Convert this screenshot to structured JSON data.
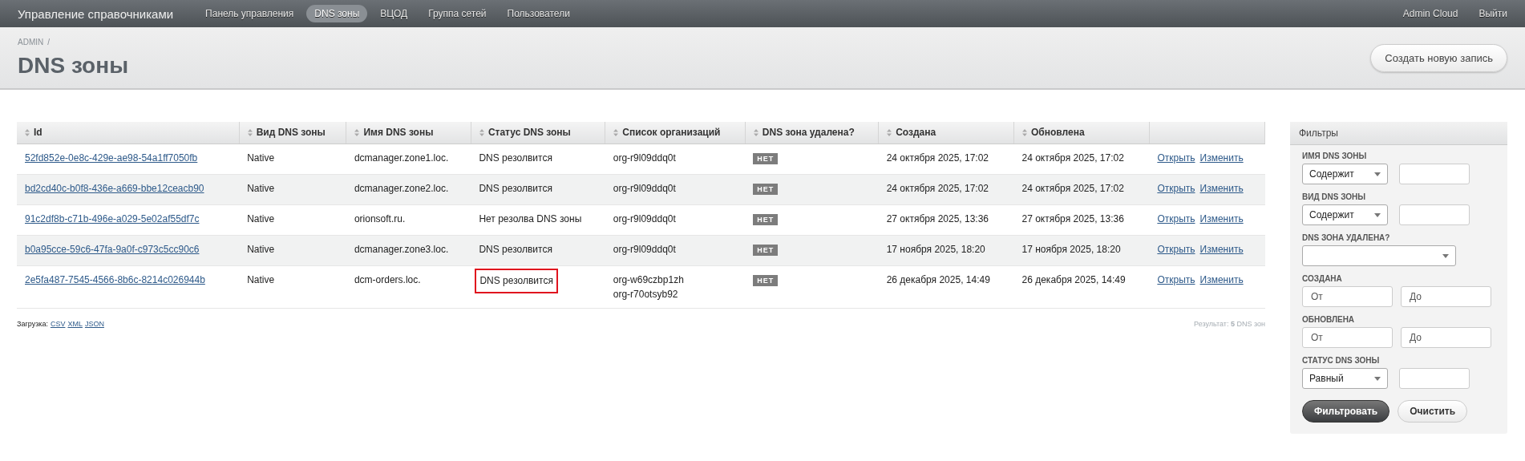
{
  "navbar": {
    "brand": "Управление справочниками",
    "items": [
      {
        "label": "Панель управления",
        "selected": false
      },
      {
        "label": "DNS зоны",
        "selected": true
      },
      {
        "label": "ВЦОД",
        "selected": false
      },
      {
        "label": "Группа сетей",
        "selected": false
      },
      {
        "label": "Пользователи",
        "selected": false
      }
    ],
    "right": [
      "Admin Cloud",
      "Выйти"
    ]
  },
  "breadcrumb": [
    "ADMIN",
    "/"
  ],
  "title": "DNS зоны",
  "create_button": "Создать новую запись",
  "table": {
    "columns": [
      "Id",
      "Вид DNS зоны",
      "Имя DNS зоны",
      "Статус DNS зоны",
      "Список организаций",
      "DNS зона удалена?",
      "Создана",
      "Обновлена"
    ],
    "rows": [
      {
        "id": "52fd852e-0e8c-429e-ae98-54a1ff7050fb",
        "kind": "Native",
        "name": "dcmanager.zone1.loc.",
        "status": "DNS резолвится",
        "status_highlighted": false,
        "orgs": [
          "org-r9l09ddq0t"
        ],
        "deleted": "НЕТ",
        "created": "24 октября 2025, 17:02",
        "updated": "24 октября 2025, 17:02",
        "actions": [
          "Открыть",
          "Изменить"
        ]
      },
      {
        "id": "bd2cd40c-b0f8-436e-a669-bbe12ceacb90",
        "kind": "Native",
        "name": "dcmanager.zone2.loc.",
        "status": "DNS резолвится",
        "status_highlighted": false,
        "orgs": [
          "org-r9l09ddq0t"
        ],
        "deleted": "НЕТ",
        "created": "24 октября 2025, 17:02",
        "updated": "24 октября 2025, 17:02",
        "actions": [
          "Открыть",
          "Изменить"
        ]
      },
      {
        "id": "91c2df8b-c71b-496e-a029-5e02af55df7c",
        "kind": "Native",
        "name": "orionsoft.ru.",
        "status": "Нет резолва DNS зоны",
        "status_highlighted": false,
        "orgs": [
          "org-r9l09ddq0t"
        ],
        "deleted": "НЕТ",
        "created": "27 октября 2025, 13:36",
        "updated": "27 октября 2025, 13:36",
        "actions": [
          "Открыть",
          "Изменить"
        ]
      },
      {
        "id": "b0a95cce-59c6-47fa-9a0f-c973c5cc90c6",
        "kind": "Native",
        "name": "dcmanager.zone3.loc.",
        "status": "DNS резолвится",
        "status_highlighted": false,
        "orgs": [
          "org-r9l09ddq0t"
        ],
        "deleted": "НЕТ",
        "created": "17 ноября 2025, 18:20",
        "updated": "17 ноября 2025, 18:20",
        "actions": [
          "Открыть",
          "Изменить"
        ]
      },
      {
        "id": "2e5fa487-7545-4566-8b6c-8214c026944b",
        "kind": "Native",
        "name": "dcm-orders.loc.",
        "status": "DNS резолвится",
        "status_highlighted": true,
        "orgs": [
          "org-w69czbp1zh",
          "org-r70otsyb92"
        ],
        "deleted": "НЕТ",
        "created": "26 декабря 2025, 14:49",
        "updated": "26 декабря 2025, 14:49",
        "actions": [
          "Открыть",
          "Изменить"
        ]
      }
    ]
  },
  "download": {
    "label": "Загрузка:",
    "links": [
      "CSV",
      "XML",
      "JSON"
    ]
  },
  "result": "Результат: **5** DNS зон",
  "filters": {
    "title": "Фильтры",
    "items": [
      {
        "kind": "select_text",
        "label": "ИМЯ DNS ЗОНЫ",
        "select": "Содержит"
      },
      {
        "kind": "select_text",
        "label": "ВИД DNS ЗОНЫ",
        "select": "Содержит"
      },
      {
        "kind": "select",
        "label": "DNS ЗОНА УДАЛЕНА?"
      },
      {
        "kind": "range",
        "label": "СОЗДАНА",
        "fields": [
          {
            "placeholder": "От"
          },
          {
            "placeholder": "До"
          }
        ]
      },
      {
        "kind": "range",
        "label": "ОБНОВЛЕНА",
        "fields": [
          {
            "placeholder": "От"
          },
          {
            "placeholder": "До"
          }
        ]
      },
      {
        "kind": "select_text",
        "label": "СТАТУС DNS ЗОНЫ",
        "select": "Равный"
      }
    ],
    "buttons": [
      "Фильтровать",
      "Очистить"
    ]
  }
}
